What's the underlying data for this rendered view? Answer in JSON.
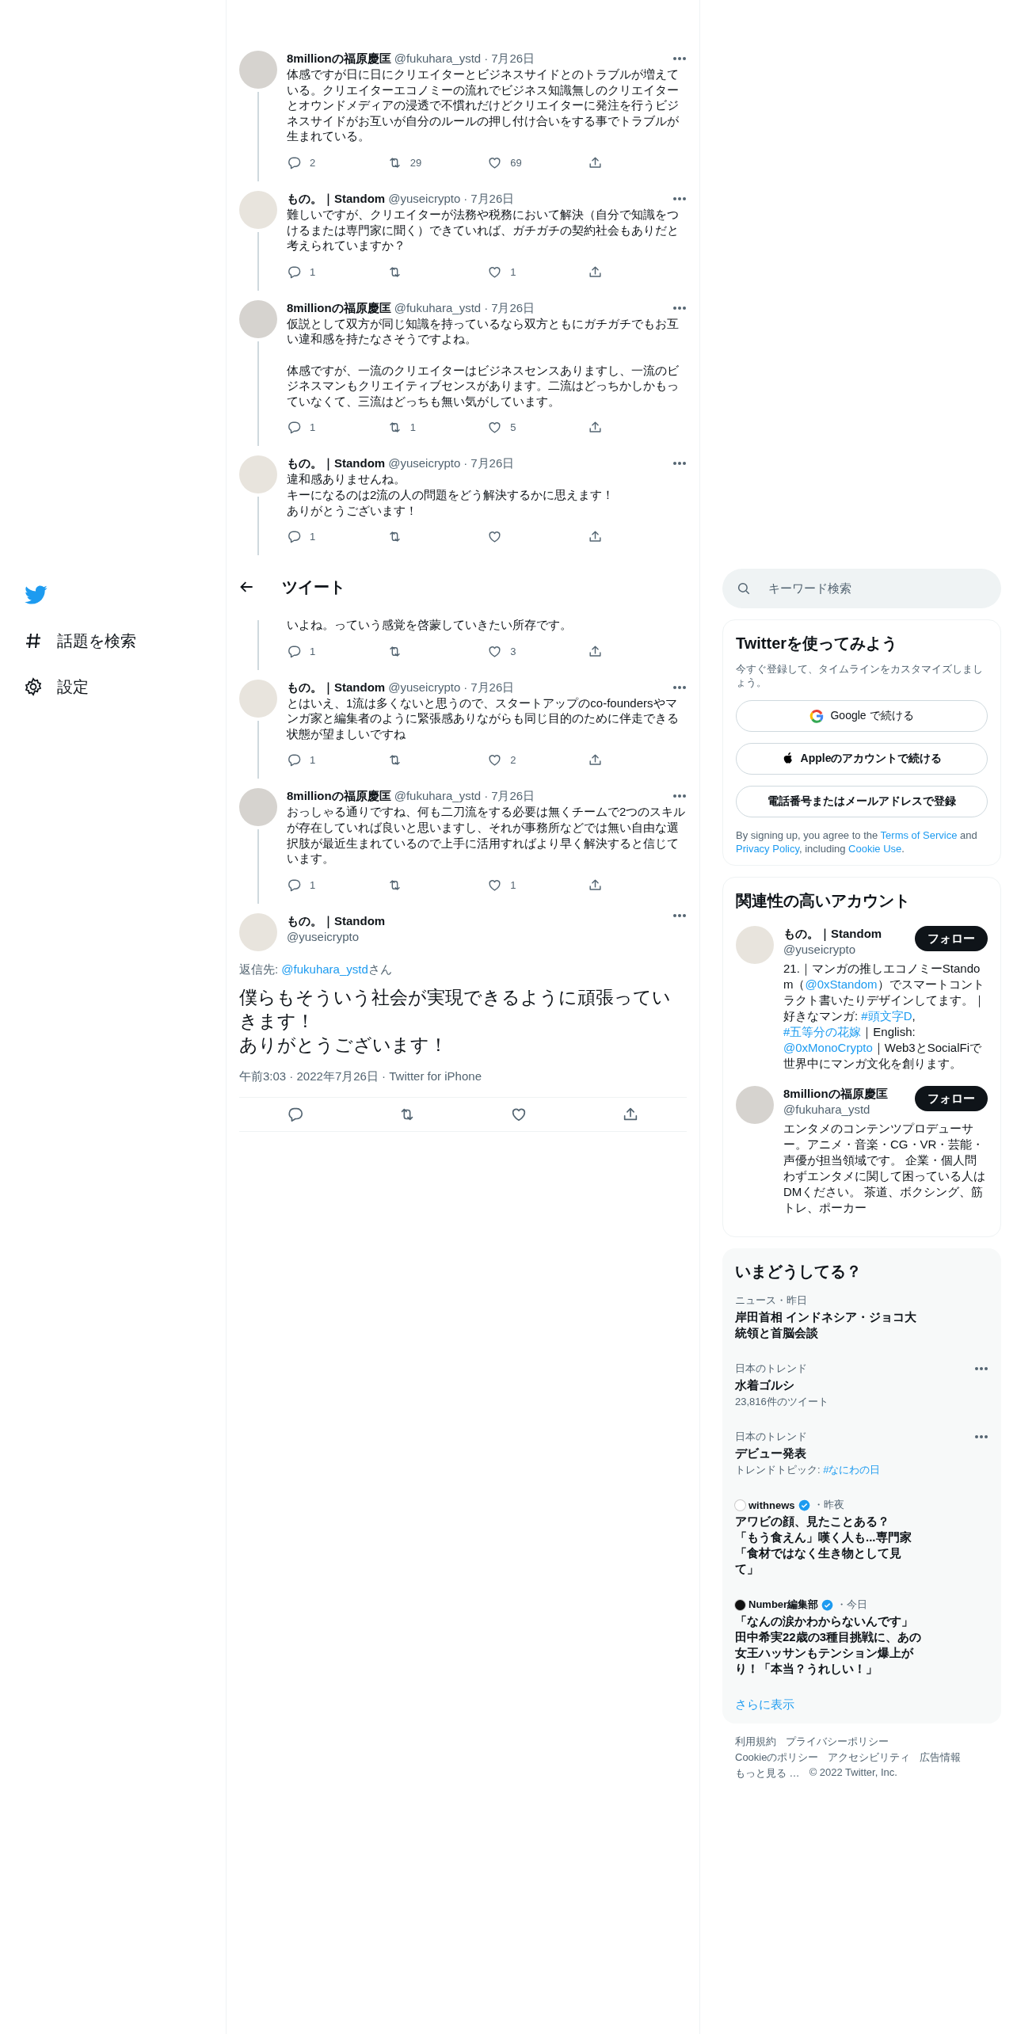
{
  "nav": {
    "items": [
      {
        "kind": "logo"
      },
      {
        "kind": "explore",
        "label": "話題を検索"
      },
      {
        "kind": "settings",
        "label": "設定"
      }
    ]
  },
  "main": {
    "tweets_above": [
      {
        "name": "8millionの福原慶匡",
        "handle": "@fukuhara_ystd",
        "separator": "·",
        "date": "7月26日",
        "paragraphs": [
          [
            "体感ですが日に日にクリエイターとビジネスサイドとのトラブルが増えている。クリエイターエコノミーの流れでビジネス知識無しのクリエイターとオウンドメディアの浸透で不慣れだけどクリエイターに発注を行うビジネスサイドがお互いが自分のルールの押し付け合いをする事でトラブルが生まれている。"
          ]
        ],
        "replies": "2",
        "retweets": "29",
        "likes": "69"
      },
      {
        "name": "もの。｜Standom",
        "handle": "@yuseicrypto",
        "separator": "·",
        "date": "7月26日",
        "paragraphs": [
          [
            "難しいですが、クリエイターが法務や税務において解決（自分で知識をつけるまたは専門家に聞く）できていれば、ガチガチの契約社会もありだと考えられていますか？"
          ]
        ],
        "replies": "1",
        "likes": "1"
      },
      {
        "name": "8millionの福原慶匡",
        "handle": "@fukuhara_ystd",
        "separator": "·",
        "date": "7月26日",
        "paragraphs": [
          [
            "仮説として双方が同じ知識を持っているなら双方ともにガチガチでもお互い違和感を持たなさそうですよね。"
          ],
          [
            "体感ですが、一流のクリエイターはビジネスセンスありますし、一流のビジネスマンもクリエイティブセンスがあります。二流はどっちかしかもっていなくて、三流はどっちも無い気がしています。"
          ]
        ],
        "replies": "1",
        "retweets": "1",
        "likes": "5"
      },
      {
        "name": "もの。｜Standom",
        "handle": "@yuseicrypto",
        "separator": "·",
        "date": "7月26日",
        "paragraphs": [
          [
            "違和感ありませんね。",
            "キーになるのは2流の人の問題をどう解決するかに思えます！",
            "ありがとうございます！"
          ]
        ],
        "replies": "1"
      }
    ],
    "header": {
      "title": "ツイート"
    },
    "tweets_below": [
      {
        "paragraphs": [
          [
            "いよね。っていう感覚を啓蒙していきたい所存です。"
          ]
        ],
        "replies": "1",
        "likes": "3"
      },
      {
        "name": "もの。｜Standom",
        "handle": "@yuseicrypto",
        "separator": "·",
        "date": "7月26日",
        "paragraphs": [
          [
            "とはいえ、1流は多くないと思うので、スタートアップのco-foundersやマンガ家と編集者のように緊張感ありながらも同じ目的のために伴走できる状態が望ましいですね"
          ]
        ],
        "replies": "1",
        "likes": "2"
      },
      {
        "name": "8millionの福原慶匡",
        "handle": "@fukuhara_ystd",
        "separator": "·",
        "date": "7月26日",
        "paragraphs": [
          [
            "おっしゃる通りですね、何も二刀流をする必要は無くチームで2つのスキルが存在していれば良いと思いますし、それが事務所などでは無い自由な選択肢が最近生まれているので上手に活用すればより早く解決すると信じています。"
          ]
        ],
        "replies": "1",
        "likes": "1"
      }
    ],
    "focused": {
      "name": "もの。｜Standom",
      "handle": "@yuseicrypto",
      "reply_prefix": "返信先: ",
      "reply_handle": "@fukuhara_ystd",
      "reply_suffix": "さん",
      "lines": [
        "僕らもそういう社会が実現できるように頑張っていきます！",
        "ありがとうございます！"
      ],
      "meta": "午前3:03 · 2022年7月26日 · Twitter for iPhone"
    }
  },
  "sidebar": {
    "search": {
      "placeholder": "キーワード検索"
    },
    "signup": {
      "title": "Twitterを使ってみよう",
      "subtitle": "今すぐ登録して、タイムラインをカスタマイズしましょう。",
      "buttons": [
        {
          "kind": "google",
          "label": "Google で続ける"
        },
        {
          "kind": "apple",
          "label": "Appleのアカウントで続ける"
        },
        {
          "kind": "phone",
          "label": "電話番号またはメールアドレスで登録"
        }
      ],
      "legal": [
        {
          "kind": "text",
          "text": "By signing up, you agree to the "
        },
        {
          "kind": "link",
          "text": "Terms of Service"
        },
        {
          "kind": "text",
          "text": " and "
        },
        {
          "kind": "link",
          "text": "Privacy Policy"
        },
        {
          "kind": "text",
          "text": ", including "
        },
        {
          "kind": "link",
          "text": "Cookie Use"
        },
        {
          "kind": "text",
          "text": "."
        }
      ]
    },
    "who_to_follow": {
      "title": "関連性の高いアカウント",
      "accounts": [
        {
          "name": "もの。｜Standom",
          "handle": "@yuseicrypto",
          "button": "フォロー",
          "bio": [
            {
              "kind": "text",
              "text": "21.｜マンガの推しエコノミーStandom（"
            },
            {
              "kind": "link",
              "text": "@0xStandom"
            },
            {
              "kind": "text",
              "text": "）でスマートコントラクト書いたりデザインしてます。｜好きなマンガ: "
            },
            {
              "kind": "link",
              "text": "#頭文字D"
            },
            {
              "kind": "text",
              "text": ", "
            },
            {
              "kind": "link",
              "text": "#五等分の花嫁"
            },
            {
              "kind": "text",
              "text": "｜English: "
            },
            {
              "kind": "link",
              "text": "@0xMonoCrypto"
            },
            {
              "kind": "text",
              "text": "｜Web3とSocialFiで世界中にマンガ文化を創ります。"
            }
          ]
        },
        {
          "name": "8millionの福原慶匡",
          "handle": "@fukuhara_ystd",
          "button": "フォロー",
          "bio": [
            {
              "kind": "text",
              "text": "エンタメのコンテンツプロデューサー。アニメ・音楽・CG・VR・芸能・声優が担当領域です。 企業・個人問わずエンタメに関して困っている人はDMください。 茶道、ボクシング、筋トレ、ポーカー"
            }
          ]
        }
      ]
    },
    "trends": {
      "title": "いまどうしてる？",
      "items": [
        {
          "kind": "news",
          "context": "ニュース・昨日",
          "title": [
            "岸田首相 インドネシア・ジョコ大統領と首脳会談"
          ]
        },
        {
          "kind": "trend",
          "context": "日本のトレンド",
          "title": [
            "水着ゴルシ"
          ],
          "sub": [
            {
              "kind": "text",
              "text": "23,816件のツイート"
            }
          ]
        },
        {
          "kind": "trend",
          "context": "日本のトレンド",
          "title": [
            "デビュー発表"
          ],
          "sub": [
            {
              "kind": "text",
              "text": "トレンドトピック: "
            },
            {
              "kind": "link",
              "text": "#なにわの日"
            }
          ]
        },
        {
          "kind": "publisher",
          "color": "#ffffff",
          "source": "withnews",
          "verified": true,
          "time": "・昨夜",
          "title": [
            "アワビの顔、見たことある？",
            "「もう食えん」嘆く人も...専門家「食材ではなく生き物として見て」"
          ]
        },
        {
          "kind": "publisher",
          "color": "#111111",
          "source": "Number編集部",
          "verified": true,
          "time": "・今日",
          "title": [
            "「なんの涙かわからないんです」田中希実22歳の3種目挑戦に、あの女王ハッサンもテンション爆上がり！「本当？うれしい！」"
          ]
        }
      ],
      "more": "さらに表示"
    },
    "footer": [
      "利用規約",
      "プライバシーポリシー",
      "Cookieのポリシー",
      "アクセシビリティ",
      "広告情報",
      "もっと見る …",
      "© 2022 Twitter, Inc."
    ]
  }
}
